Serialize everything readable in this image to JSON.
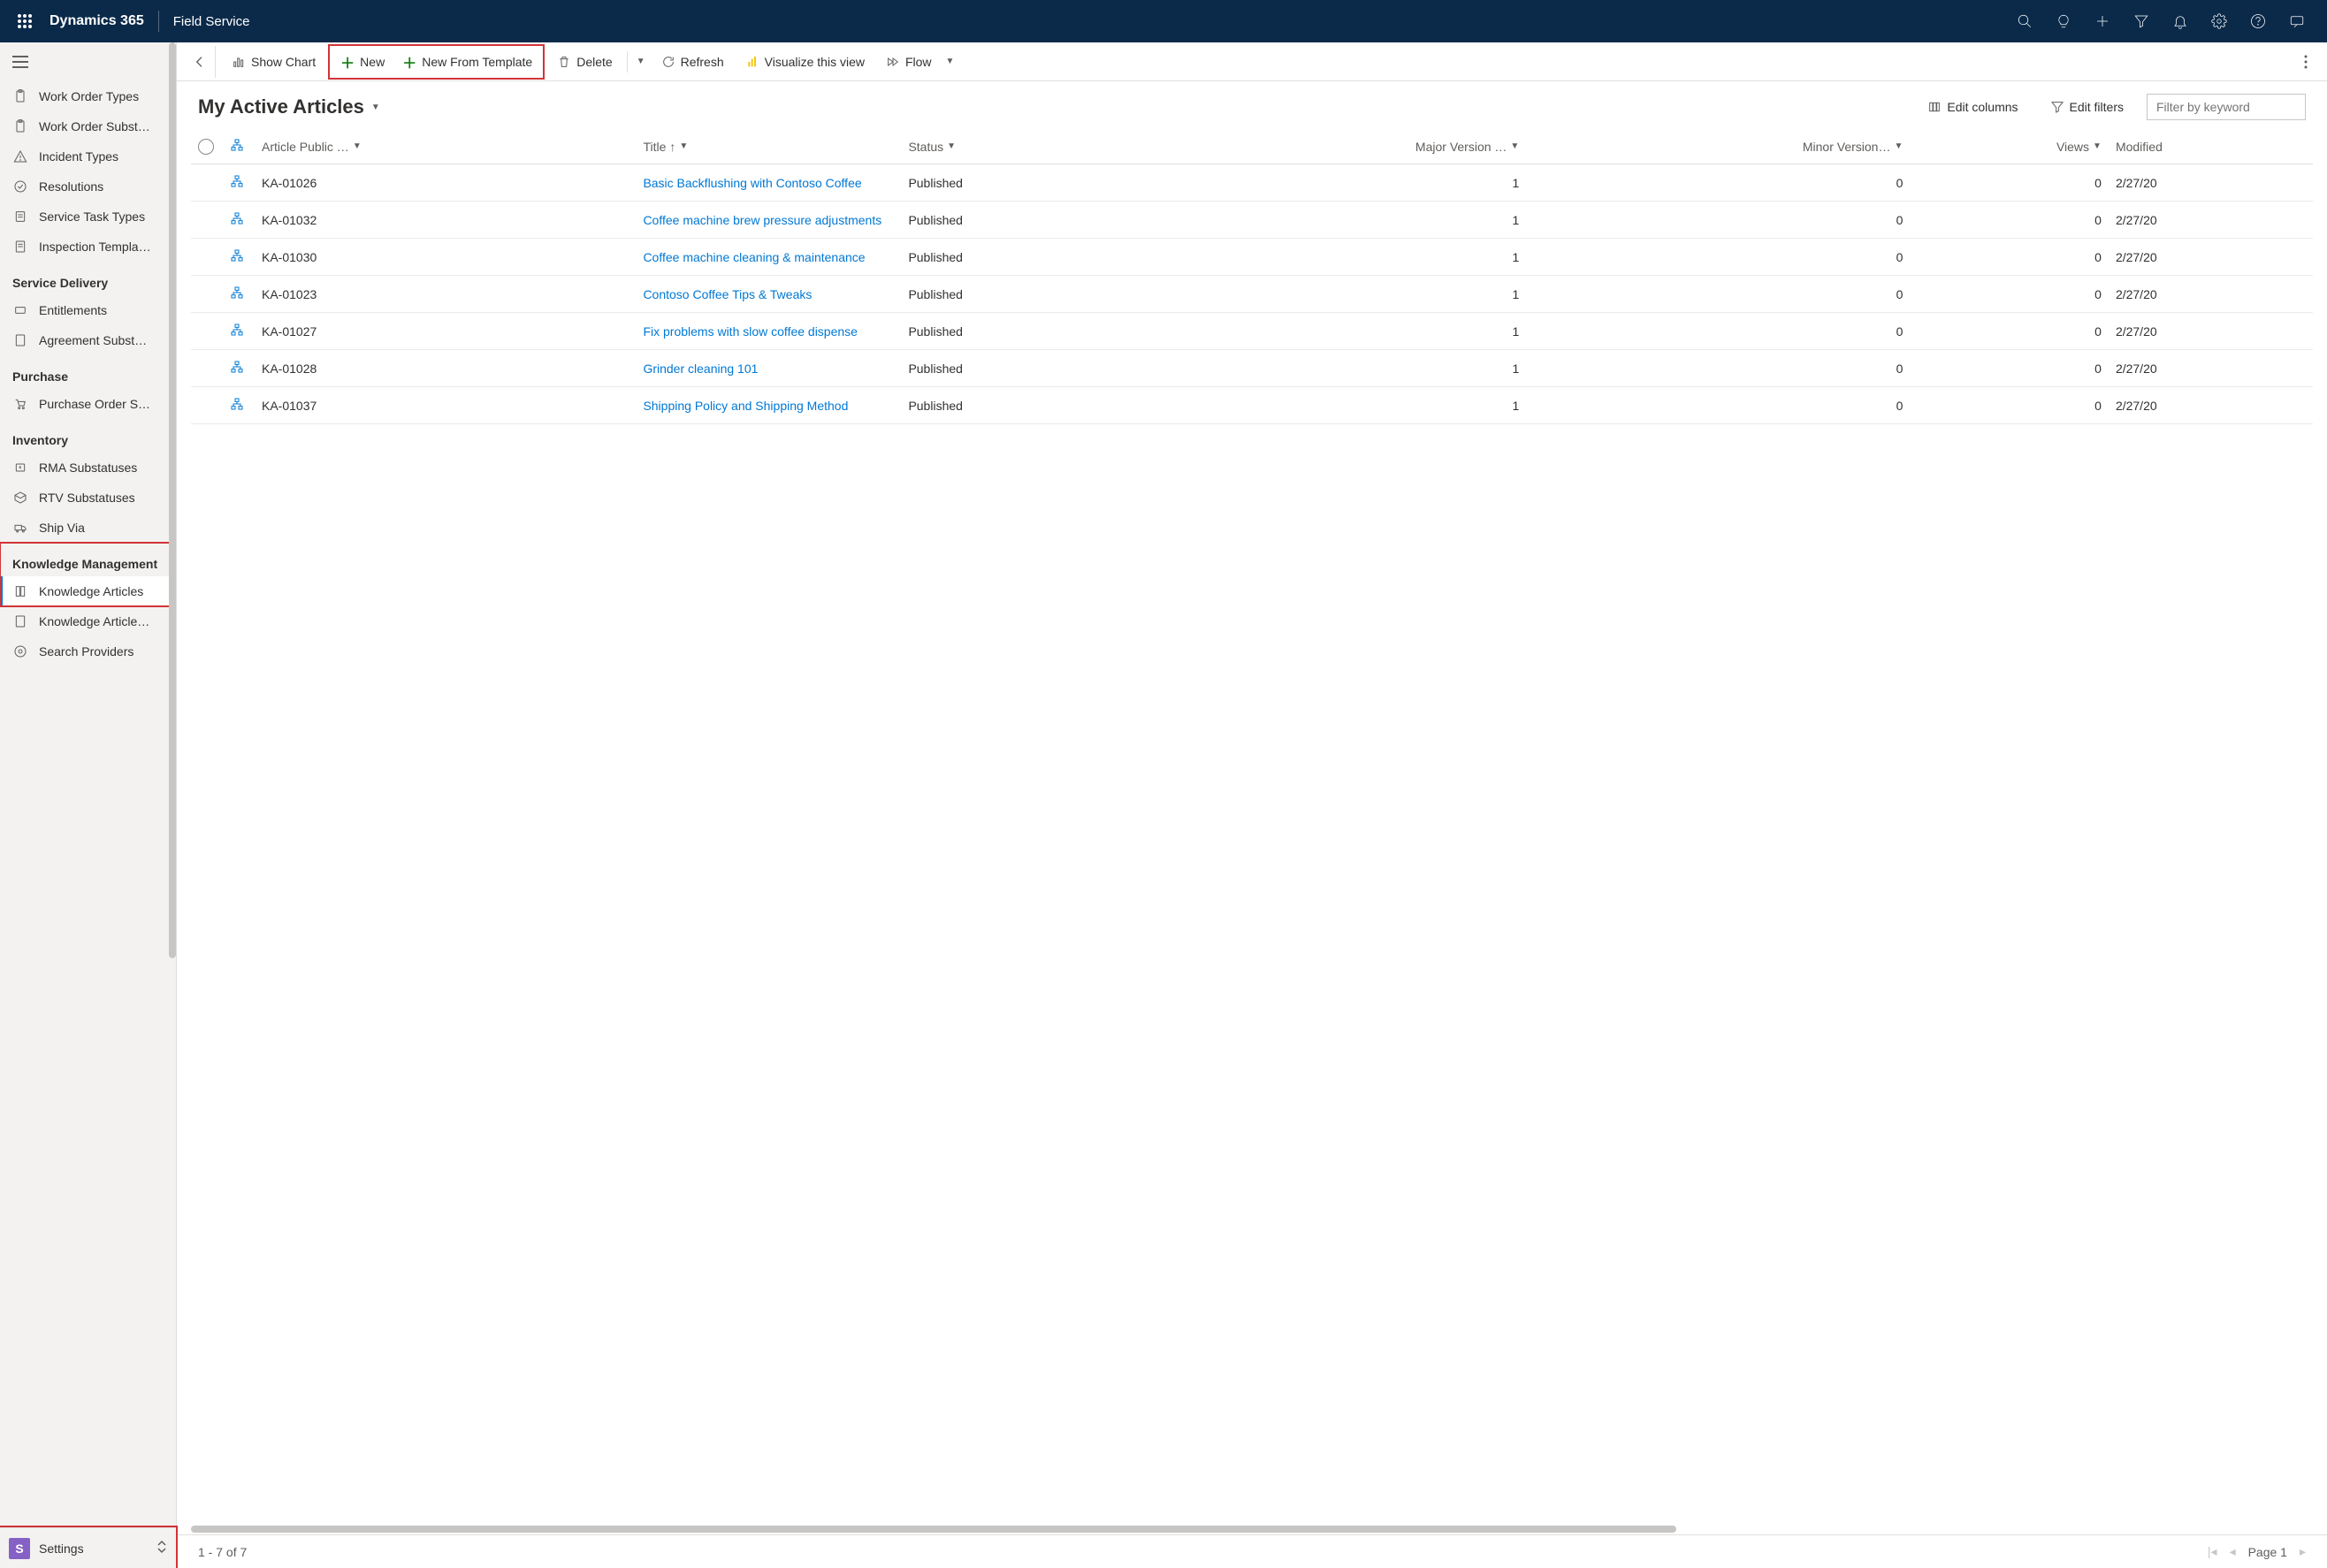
{
  "topbar": {
    "brand": "Dynamics 365",
    "module": "Field Service"
  },
  "sidebar": {
    "items_top": [
      {
        "label": "Work Order Types"
      },
      {
        "label": "Work Order Subst…"
      },
      {
        "label": "Incident Types"
      },
      {
        "label": "Resolutions"
      },
      {
        "label": "Service Task Types"
      },
      {
        "label": "Inspection Templa…"
      }
    ],
    "group_service": "Service Delivery",
    "items_service": [
      {
        "label": "Entitlements"
      },
      {
        "label": "Agreement Subst…"
      }
    ],
    "group_purchase": "Purchase",
    "items_purchase": [
      {
        "label": "Purchase Order S…"
      }
    ],
    "group_inventory": "Inventory",
    "items_inventory": [
      {
        "label": "RMA Substatuses"
      },
      {
        "label": "RTV Substatuses"
      },
      {
        "label": "Ship Via"
      }
    ],
    "group_knowledge": "Knowledge Management",
    "items_knowledge": [
      {
        "label": "Knowledge Articles"
      },
      {
        "label": "Knowledge Article…"
      },
      {
        "label": "Search Providers"
      }
    ]
  },
  "area": {
    "badge": "S",
    "label": "Settings"
  },
  "cmdbar": {
    "show_chart": "Show Chart",
    "new": "New",
    "new_from_template": "New From Template",
    "delete": "Delete",
    "refresh": "Refresh",
    "visualize": "Visualize this view",
    "flow": "Flow"
  },
  "view": {
    "title": "My Active Articles",
    "edit_columns": "Edit columns",
    "edit_filters": "Edit filters",
    "filter_placeholder": "Filter by keyword"
  },
  "columns": {
    "article_public": "Article Public …",
    "title": "Title",
    "status": "Status",
    "major": "Major Version …",
    "minor": "Minor Version…",
    "views": "Views",
    "modified": "Modified"
  },
  "rows": [
    {
      "public": "KA-01026",
      "title": "Basic Backflushing with Contoso Coffee",
      "status": "Published",
      "major": "1",
      "minor": "0",
      "views": "0",
      "modified": "2/27/20"
    },
    {
      "public": "KA-01032",
      "title": "Coffee machine brew pressure adjustments",
      "status": "Published",
      "major": "1",
      "minor": "0",
      "views": "0",
      "modified": "2/27/20"
    },
    {
      "public": "KA-01030",
      "title": "Coffee machine cleaning & maintenance",
      "status": "Published",
      "major": "1",
      "minor": "0",
      "views": "0",
      "modified": "2/27/20"
    },
    {
      "public": "KA-01023",
      "title": "Contoso Coffee Tips & Tweaks",
      "status": "Published",
      "major": "1",
      "minor": "0",
      "views": "0",
      "modified": "2/27/20"
    },
    {
      "public": "KA-01027",
      "title": "Fix problems with slow coffee dispense",
      "status": "Published",
      "major": "1",
      "minor": "0",
      "views": "0",
      "modified": "2/27/20"
    },
    {
      "public": "KA-01028",
      "title": "Grinder cleaning 101",
      "status": "Published",
      "major": "1",
      "minor": "0",
      "views": "0",
      "modified": "2/27/20"
    },
    {
      "public": "KA-01037",
      "title": "Shipping Policy and Shipping Method",
      "status": "Published",
      "major": "1",
      "minor": "0",
      "views": "0",
      "modified": "2/27/20"
    }
  ],
  "footer": {
    "range": "1 - 7 of 7",
    "page": "Page 1"
  }
}
